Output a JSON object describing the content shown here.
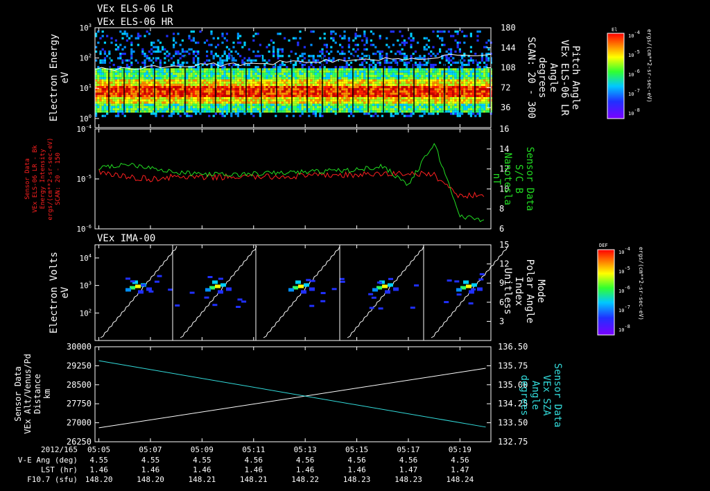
{
  "header": {
    "line1": "VEx ELS-06 LR",
    "line2": "VEx ELS-06 HR",
    "ima_title": "VEx IMA-00"
  },
  "colors": {
    "background": "#000000",
    "foreground": "#ffffff",
    "sensor_red": "#ff2020",
    "sensor_green": "#22dd22",
    "sza_cyan": "#33dddd"
  },
  "chart_data": [
    {
      "type": "heatmap",
      "name": "ELS electron spectrogram",
      "ylabel": [
        "Electron Energy",
        "eV"
      ],
      "yscale": "log",
      "yticks": [
        "10^0",
        "10^1",
        "10^2",
        "10^3"
      ],
      "ylim": [
        0.5,
        1000
      ],
      "right_ylabel": [
        "Pitch Angle",
        "VEx ELS-06 LR",
        "Angle",
        "degrees",
        "SCAN: 20 - 300"
      ],
      "right_yticks": [
        36,
        72,
        108,
        144,
        180
      ],
      "right_ylim": [
        0,
        180
      ],
      "peak_band_energy_eV": 9,
      "colorbar": {
        "label": "El",
        "units": "ergs/(cm**2-sr-sec-eV)",
        "ticks": [
          "10^-4",
          "10^-5",
          "10^-6",
          "10^-7",
          "10^-8"
        ]
      }
    },
    {
      "type": "line",
      "name": "Sensor data panel",
      "left_ylabel": [
        "Sensor Data",
        "VEx ELS-06 LR - Bk",
        "Energy Intensity",
        "ergs/(cm**2-sr-sec-eV)",
        "SCAN: 20 - 150"
      ],
      "left_yscale": "log",
      "left_yticks": [
        "10^-6",
        "10^-5",
        "10^-4"
      ],
      "left_ylim": [
        1e-06,
        0.0001
      ],
      "right_ylabel": [
        "Sensor Data",
        "S/C B",
        "Nanotesla",
        "nT"
      ],
      "right_yticks": [
        6,
        8,
        10,
        12,
        14,
        16
      ],
      "right_ylim": [
        6,
        16
      ],
      "series": [
        {
          "name": "Energy Intensity",
          "axis": "left",
          "color": "#ff2020",
          "x": [
            "05:05",
            "05:06",
            "05:07",
            "05:08",
            "05:09",
            "05:10",
            "05:11",
            "05:12",
            "05:13",
            "05:14",
            "05:15",
            "05:16",
            "05:17",
            "05:18",
            "05:19",
            "05:20"
          ],
          "values": [
            1.4e-05,
            1.1e-05,
            1e-05,
            1.1e-05,
            1.05e-05,
            1.1e-05,
            1.1e-05,
            1.1e-05,
            1.15e-05,
            1.2e-05,
            1.2e-05,
            1.25e-05,
            1.3e-05,
            1.2e-05,
            4.5e-06,
            5e-06
          ]
        },
        {
          "name": "S/C B",
          "axis": "right",
          "color": "#22dd22",
          "x": [
            "05:05",
            "05:06",
            "05:07",
            "05:08",
            "05:09",
            "05:10",
            "05:11",
            "05:12",
            "05:13",
            "05:14",
            "05:15",
            "05:16",
            "05:17",
            "05:18",
            "05:19",
            "05:20"
          ],
          "values": [
            12.0,
            12.5,
            12.2,
            11.6,
            11.5,
            11.4,
            11.5,
            11.6,
            11.7,
            11.8,
            11.9,
            12.3,
            10.4,
            14.6,
            7.3,
            6.8
          ]
        }
      ]
    },
    {
      "type": "heatmap",
      "name": "IMA ion spectrogram",
      "ylabel": [
        "Electron Volts",
        "eV"
      ],
      "yscale": "log",
      "yticks": [
        "10^2",
        "10^3",
        "10^4"
      ],
      "ylim": [
        10,
        30000
      ],
      "right_ylabel": [
        "Mode",
        "Polar Angle",
        "Index",
        "Unitless"
      ],
      "right_yticks": [
        3,
        6,
        9,
        12,
        15
      ],
      "right_ylim": [
        0,
        15
      ],
      "ion_energy_eV": 900,
      "colorbar": {
        "label": "DEF",
        "units": "ergs/(cm**2-sr-sec-eV)",
        "ticks": [
          "10^-4",
          "10^-5",
          "10^-6",
          "10^-7",
          "10^-8"
        ]
      }
    },
    {
      "type": "line",
      "name": "Position panel",
      "left_ylabel": [
        "Sensor Data",
        "VEx Alt/Venus/Pd",
        "Distance",
        "km"
      ],
      "left_yticks": [
        26250,
        27000,
        27750,
        28500,
        29250,
        30000
      ],
      "left_ylim": [
        26250,
        30000
      ],
      "right_ylabel": [
        "Sensor Data",
        "VEx SZA",
        "Angle",
        "degrees"
      ],
      "right_yticks": [
        "132.75",
        "133.50",
        "134.25",
        "135.00",
        "135.75",
        "136.50"
      ],
      "right_ylim": [
        132.75,
        136.5
      ],
      "series": [
        {
          "name": "Distance",
          "axis": "left",
          "color": "#ffffff",
          "x": [
            "05:05",
            "05:20"
          ],
          "values": [
            26800,
            29150
          ]
        },
        {
          "name": "SZA",
          "axis": "right",
          "color": "#33dddd",
          "x": [
            "05:05",
            "05:20"
          ],
          "values": [
            135.95,
            133.33
          ]
        }
      ]
    }
  ],
  "xaxis": {
    "ticks": [
      "05:05",
      "05:07",
      "05:09",
      "05:11",
      "05:13",
      "05:15",
      "05:17",
      "05:19"
    ],
    "row_labels": [
      "2012/165",
      "V-E Ang (deg)",
      "LST (hr)",
      "F10.7 (sfu)"
    ],
    "ve_ang": [
      "4.55",
      "4.55",
      "4.55",
      "4.56",
      "4.56",
      "4.56",
      "4.56",
      "4.56"
    ],
    "lst": [
      "1.46",
      "1.46",
      "1.46",
      "1.46",
      "1.46",
      "1.46",
      "1.47",
      "1.47"
    ],
    "f107": [
      "148.20",
      "148.20",
      "148.21",
      "148.21",
      "148.22",
      "148.23",
      "148.23",
      "148.24"
    ]
  }
}
